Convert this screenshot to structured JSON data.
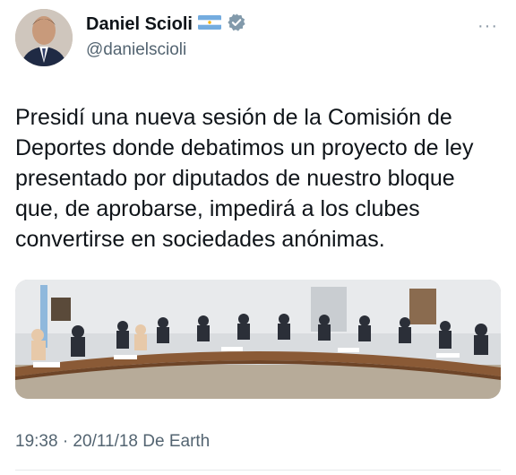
{
  "author": {
    "name": "Daniel Scioli",
    "handle": "@danielscioli",
    "flag_icon": "argentina-flag-icon",
    "verified_icon": "verified-badge-icon"
  },
  "more_label": "···",
  "tweet": {
    "lines": [
      "Presidí una nueva sesión de la Comisión de",
      "Deportes donde debatimos un proyecto de ley",
      "presentado por diputados de nuestro bloque",
      "que, de aprobarse, impedirá a los clubes",
      "convertirse en sociedades anónimas."
    ]
  },
  "meta": "19:38 · 20/11/18 De Earth",
  "colors": {
    "text": "#0f1419",
    "secondary": "#536471",
    "verified": "#829aab"
  }
}
